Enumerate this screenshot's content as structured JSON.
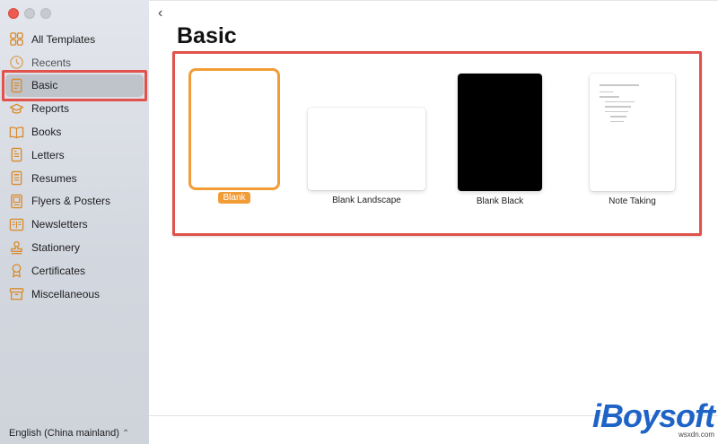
{
  "sidebar": {
    "items": [
      {
        "label": "All Templates",
        "icon": "grid-icon"
      },
      {
        "label": "Recents",
        "icon": "clock-icon"
      },
      {
        "label": "Basic",
        "icon": "document-icon",
        "selected": true
      },
      {
        "label": "Reports",
        "icon": "graduation-cap-icon"
      },
      {
        "label": "Books",
        "icon": "book-icon"
      },
      {
        "label": "Letters",
        "icon": "letter-icon"
      },
      {
        "label": "Resumes",
        "icon": "resume-icon"
      },
      {
        "label": "Flyers & Posters",
        "icon": "flyer-icon"
      },
      {
        "label": "Newsletters",
        "icon": "newsletter-icon"
      },
      {
        "label": "Stationery",
        "icon": "stamp-icon"
      },
      {
        "label": "Certificates",
        "icon": "ribbon-icon"
      },
      {
        "label": "Miscellaneous",
        "icon": "box-icon"
      }
    ],
    "language": "English (China mainland)",
    "language_caret": "⌃"
  },
  "main": {
    "back_glyph": "‹",
    "title": "Basic",
    "templates": [
      {
        "label": "Blank",
        "selected": true
      },
      {
        "label": "Blank Landscape"
      },
      {
        "label": "Blank Black"
      },
      {
        "label": "Note Taking"
      }
    ]
  },
  "watermark": {
    "logo": "iBoysoft",
    "sub": "wsxdn.com"
  },
  "colors": {
    "accent": "#f29c38",
    "highlight": "#e0524b",
    "icon": "#d98a2b",
    "watermark": "#1e63c6"
  }
}
